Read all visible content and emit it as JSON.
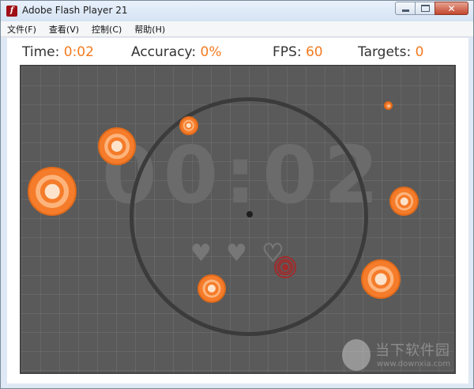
{
  "window": {
    "title": "Adobe Flash Player 21"
  },
  "menu": {
    "items": [
      "文件(F)",
      "查看(V)",
      "控制(C)",
      "帮助(H)"
    ]
  },
  "hud": {
    "time_label": "Time:",
    "time_value": "0:02",
    "accuracy_label": "Accuracy:",
    "accuracy_value": "0%",
    "fps_label": "FPS:",
    "fps_value": "60",
    "targets_label": "Targets:",
    "targets_value": "0"
  },
  "game": {
    "big_timer": "00:02",
    "hearts_filled": 2,
    "hearts_total": 3
  },
  "colors": {
    "target_orange": "#f57c2a",
    "hud_value": "#f47b20",
    "arena_bg": "#5a5a5a"
  },
  "watermark": {
    "text": "当下软件园",
    "url": "www.downxia.com"
  }
}
